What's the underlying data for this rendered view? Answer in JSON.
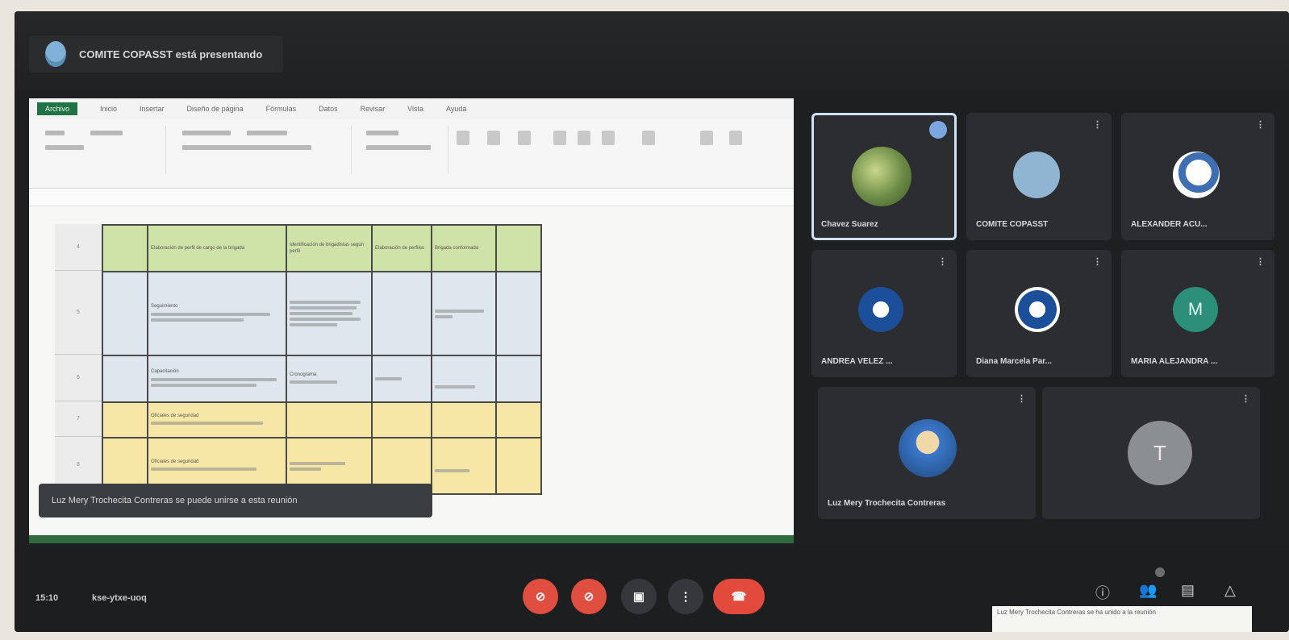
{
  "presenter": {
    "label": "COMITE COPASST está presentando"
  },
  "excel": {
    "file_tab": "Archivo",
    "tabs": [
      "Inicio",
      "Insertar",
      "Diseño de página",
      "Fórmulas",
      "Datos",
      "Revisar",
      "Vista",
      "Ayuda"
    ],
    "table_rows": [
      {
        "style": "green",
        "num": "4",
        "c1": "",
        "c2": "Elaboración de perfil de cargo de la brigada",
        "c3": "Identificación de brigadistas según perfil",
        "c4": "Elaboración de perfiles",
        "c5": "Brigada conformada",
        "c6": ""
      },
      {
        "style": "blue",
        "num": "5",
        "c1": "",
        "c2": "Seguimiento",
        "c3": "",
        "c4": "",
        "c5": "",
        "c6": ""
      },
      {
        "style": "blue",
        "num": "6",
        "c1": "",
        "c2": "Capacitación",
        "c3": "Cronograma",
        "c4": "",
        "c5": "",
        "c6": ""
      },
      {
        "style": "yellow",
        "num": "7",
        "c1": "",
        "c2": "Oficiales de seguridad",
        "c3": "",
        "c4": "",
        "c5": "",
        "c6": ""
      },
      {
        "style": "yellow",
        "num": "8",
        "c1": "",
        "c2": "Oficiales de seguridad",
        "c3": "",
        "c4": "",
        "c5": "",
        "c6": ""
      }
    ]
  },
  "notification": {
    "text": "Luz Mery Trochecita Contreras se puede unirse a esta reunión"
  },
  "participants": [
    {
      "name": "Chavez Suarez",
      "active": true
    },
    {
      "name": "COMITE COPASST"
    },
    {
      "name": "ALEXANDER ACU..."
    },
    {
      "name": "ANDREA VELEZ ..."
    },
    {
      "name": "Diana Marcela Par..."
    },
    {
      "name": "MARIA ALEJANDRA ..."
    },
    {
      "name": "Luz Mery Trochecita Contreras"
    },
    {
      "name": "",
      "initial": "T"
    }
  ],
  "avatar_letters": {
    "maria": "M",
    "t": "T"
  },
  "meeting": {
    "time": "15:10",
    "code": "kse-ytxe-uoq"
  },
  "tooltip": {
    "text": "Luz Mery Trochecita Contreras se ha unido a la reunión"
  },
  "colors": {
    "accent_red": "#df4e3e",
    "excel_green": "#217346",
    "row_green": "#cfe2a8",
    "row_blue": "#dfe6ee",
    "row_yellow": "#f7e7a6"
  }
}
